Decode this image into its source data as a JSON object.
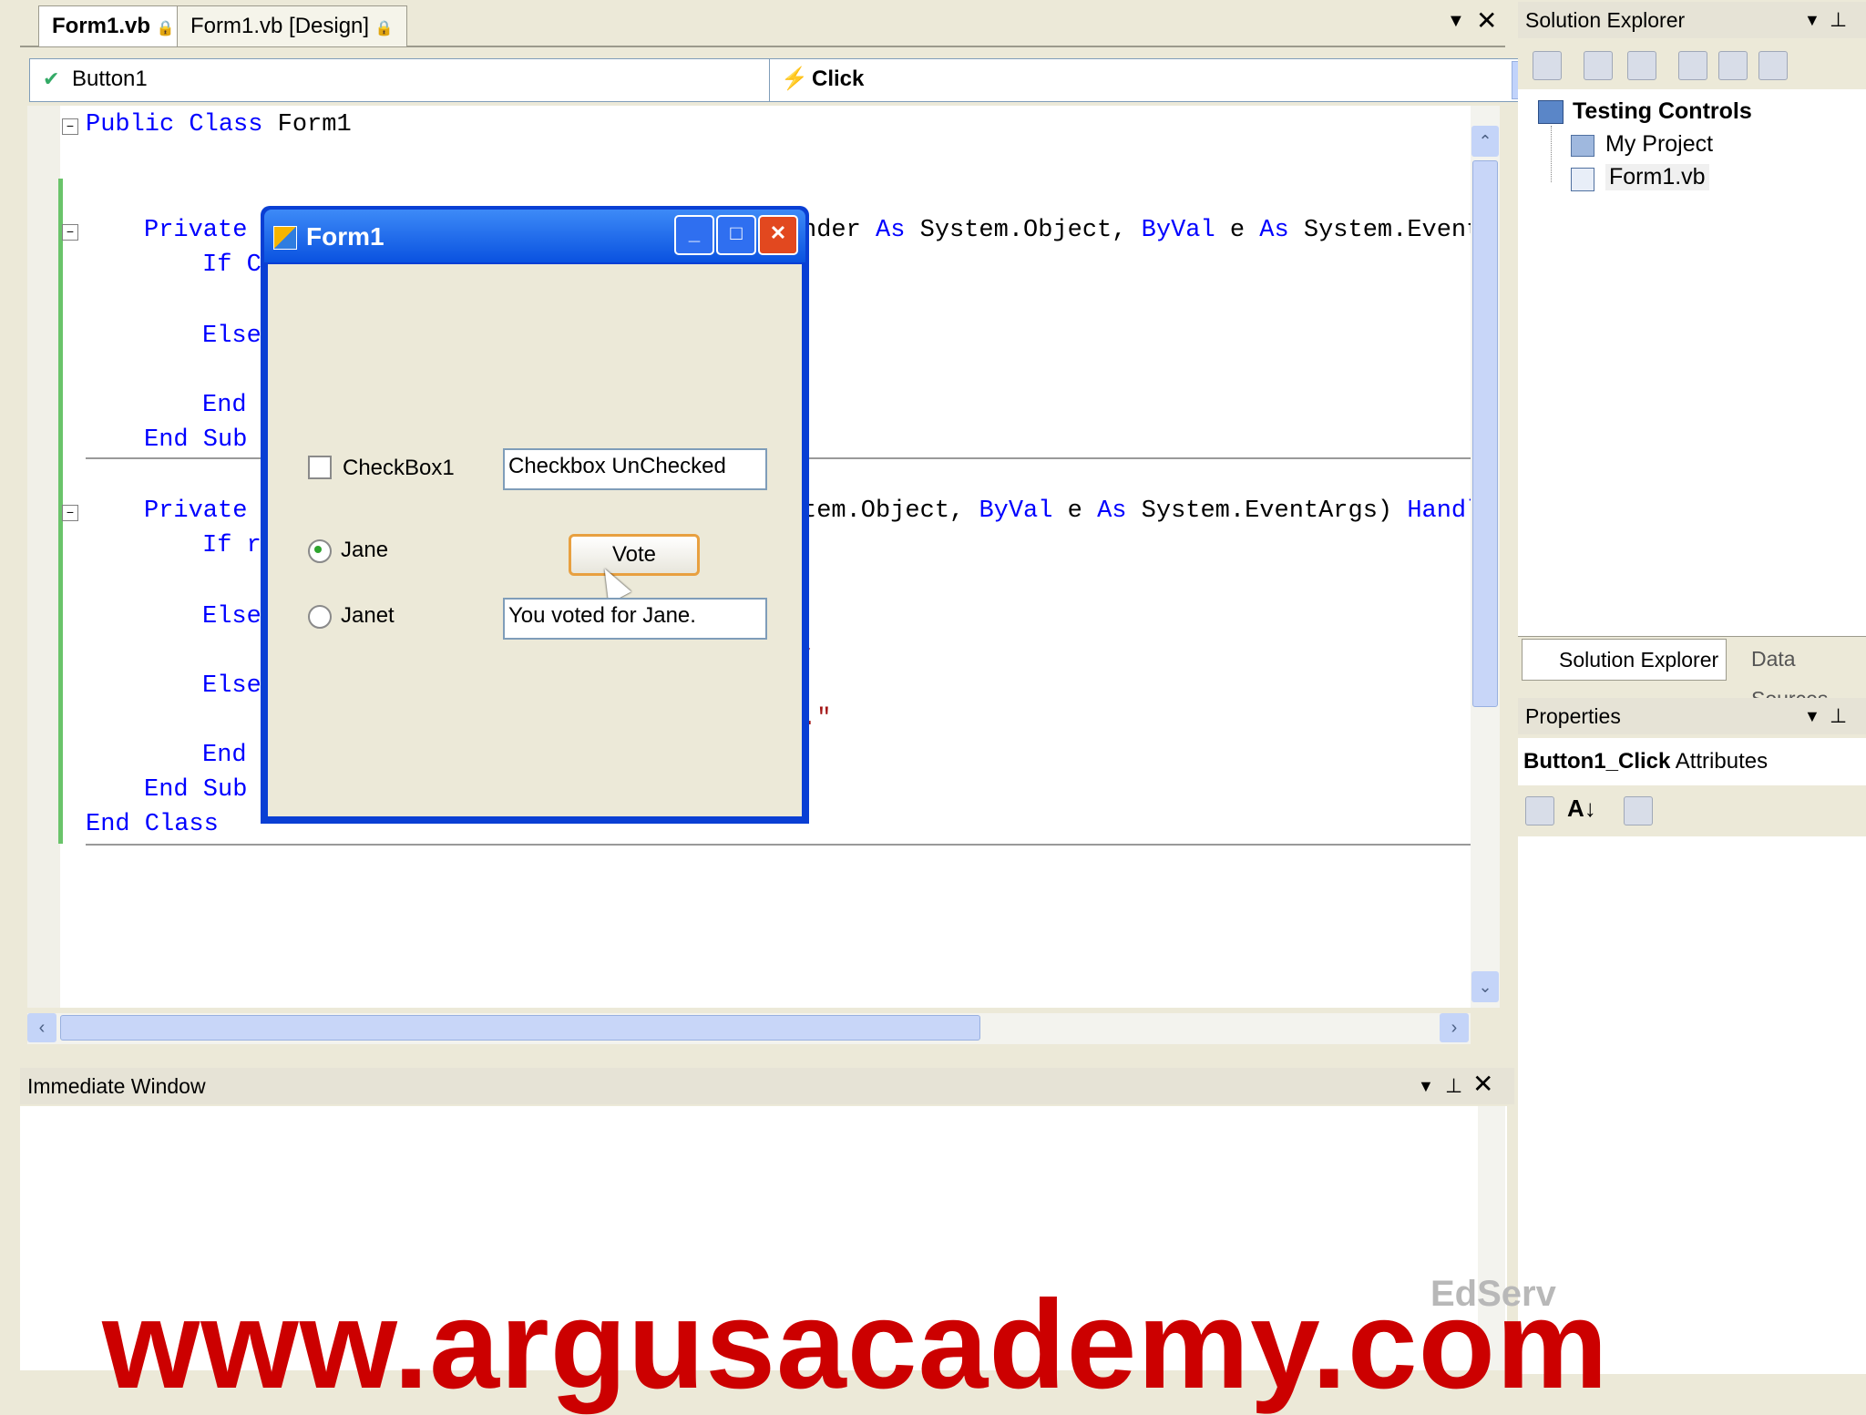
{
  "tabs": [
    {
      "label": "Form1.vb",
      "active": true
    },
    {
      "label": "Form1.vb [Design]",
      "active": false
    }
  ],
  "editor": {
    "object_combo": "Button1",
    "event_combo": "Click",
    "lines": {
      "l1_kw": "Public Class",
      "l1_rest": " Form1",
      "l2_kw": "Private",
      "l2_rest_a": "nder ",
      "l2_as1": "As",
      "l2_rest_b": " System.Object, ",
      "l2_byval": "ByVal",
      "l2_rest_c": " e ",
      "l2_as2": "As",
      "l2_rest_d": " System.Event",
      "l3": "If C",
      "l4": "Else",
      "l5": "End",
      "l6": "End Sub",
      "l7_kw": "Private",
      "l7_rest_a": "tem.Object, ",
      "l7_byval": "ByVal",
      "l7_rest_b": " e ",
      "l7_as": "As",
      "l7_rest_c": " System.EventArgs) ",
      "l7_handl": "Handl",
      "l8": "If r",
      "l9": "Else",
      "l9_tail": ",",
      "l10": "Else",
      "l10_tail": ".\"",
      "l11": "End",
      "l12": "End Sub",
      "l13": "End Class"
    }
  },
  "form1": {
    "title": "Form1",
    "checkbox_label": "CheckBox1",
    "checkbox_status": "Checkbox UnChecked",
    "radio1_label": "Jane",
    "radio2_label": "Janet",
    "vote_button": "Vote",
    "result_text": "You voted for Jane."
  },
  "solution_explorer": {
    "title": "Solution Explorer",
    "project": "Testing Controls",
    "items": [
      "My Project",
      "Form1.vb"
    ],
    "tab1": "Solution Explorer",
    "tab2": "Data Sources"
  },
  "properties": {
    "title": "Properties",
    "object_name": "Button1_Click",
    "object_type": "Attributes"
  },
  "immediate": {
    "title": "Immediate Window"
  },
  "watermark": {
    "text": "www.argusacademy.com",
    "logo_text": "EdServ",
    "color": "#cc0000"
  }
}
